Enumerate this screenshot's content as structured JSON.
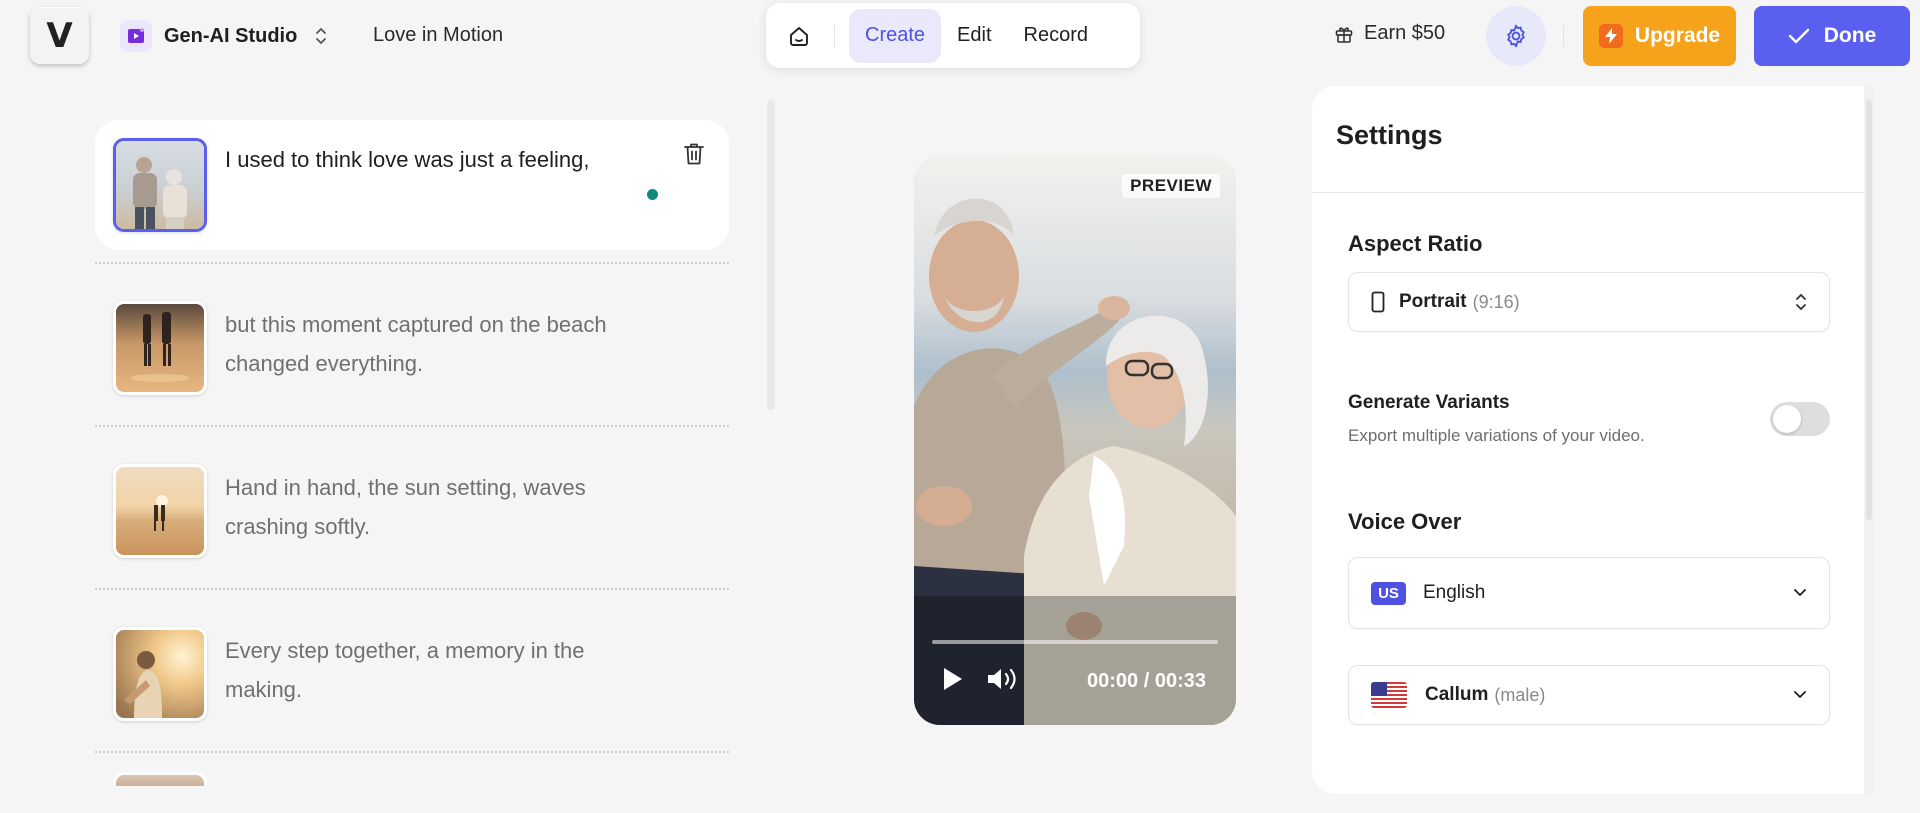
{
  "app": {
    "logo": "V",
    "studio_name": "Gen-AI Studio",
    "project_name": "Love in Motion"
  },
  "modes": {
    "tabs": [
      {
        "label": "Create",
        "active": true
      },
      {
        "label": "Edit",
        "active": false
      },
      {
        "label": "Record",
        "active": false
      }
    ]
  },
  "header": {
    "earn_label": "Earn $50",
    "upgrade_label": "Upgrade",
    "done_label": "Done",
    "accent_color": "#5a5ff0",
    "upgrade_color": "#f7a21b"
  },
  "scenes": [
    {
      "text": "I used to think love was just a feeling,",
      "active": true
    },
    {
      "text": "but this moment captured on the beach changed everything.",
      "active": false
    },
    {
      "text": "Hand in hand, the sun setting, waves crashing softly.",
      "active": false
    },
    {
      "text": "Every step together, a memory in the making.",
      "active": false
    }
  ],
  "preview": {
    "badge": "PREVIEW",
    "current_time": "00:00",
    "separator": " / ",
    "duration": "00:33",
    "progress": 0
  },
  "settings": {
    "title": "Settings",
    "aspect_ratio": {
      "label": "Aspect Ratio",
      "value": "Portrait",
      "detail": "(9:16)"
    },
    "variants": {
      "title": "Generate Variants",
      "description": "Export multiple variations of your video.",
      "enabled": false
    },
    "voice_over": {
      "label": "Voice Over",
      "language_badge": "US",
      "language": "English",
      "voice_name": "Callum",
      "voice_detail": "(male)"
    }
  }
}
